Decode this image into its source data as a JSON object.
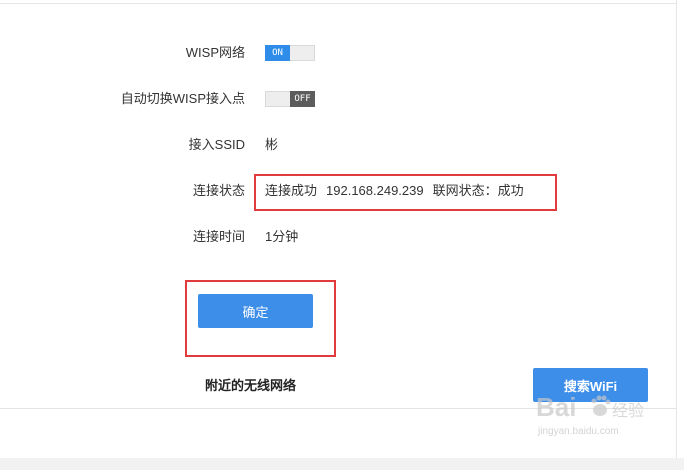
{
  "settings": {
    "wisp_network": {
      "label": "WISP网络",
      "toggle_text": "ON",
      "enabled": true
    },
    "auto_switch": {
      "label": "自动切换WISP接入点",
      "toggle_text": "OFF",
      "enabled": false
    },
    "ssid": {
      "label": "接入SSID",
      "value": "彬"
    },
    "connection_status": {
      "label": "连接状态",
      "result": "连接成功",
      "ip": "192.168.249.239",
      "internet_status": "联网状态：成功"
    },
    "connection_time": {
      "label": "连接时间",
      "value": "1分钟"
    }
  },
  "actions": {
    "confirm_label": "确定",
    "search_wifi_label": "搜索WiFi"
  },
  "nearby": {
    "title": "附近的无线网络"
  },
  "watermark": {
    "brand": "Bai",
    "brand_suffix": "经验",
    "url": "jingyan.baidu.com"
  },
  "colors": {
    "accent_blue": "#3d8ee9",
    "toggle_on": "#2f8ce9",
    "toggle_off": "#5c5c5c",
    "highlight_red": "#e23b3b"
  }
}
